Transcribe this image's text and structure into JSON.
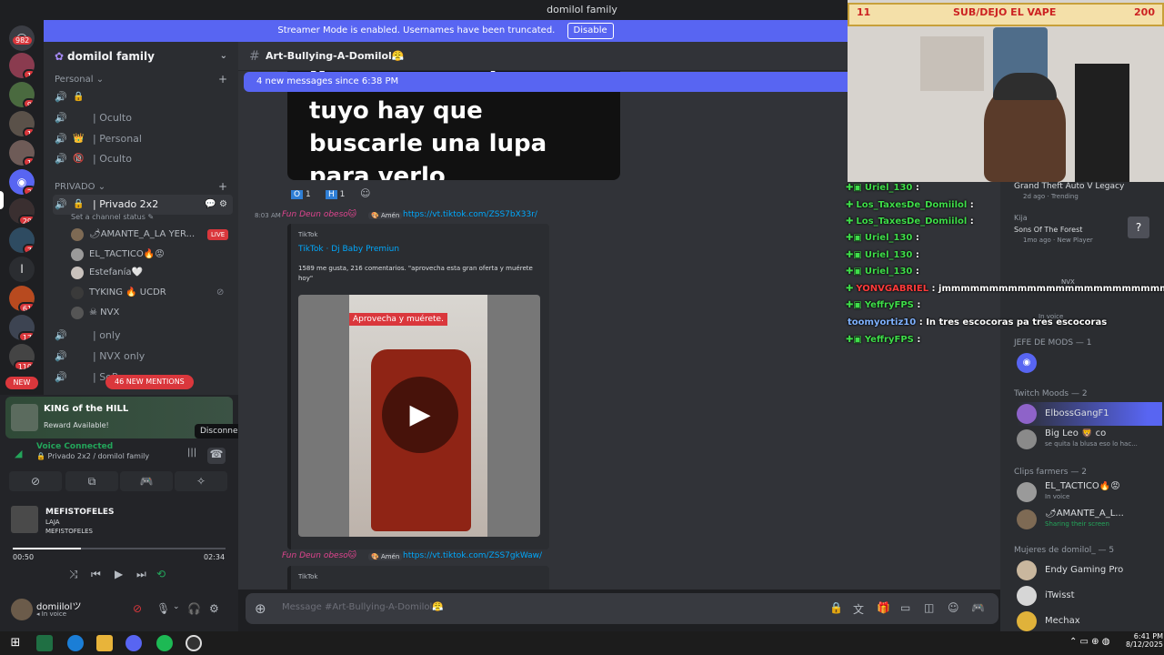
{
  "window": {
    "title": "domilol family"
  },
  "streamer_bar": {
    "text": "Streamer Mode is enabled. Usernames have been truncated.",
    "disable_label": "Disable"
  },
  "rail": {
    "top_badge": "982",
    "servers": [
      {
        "badge": "1"
      },
      {
        "badge": "9"
      },
      {
        "badge": "1"
      },
      {
        "badge": "1"
      },
      {
        "badge": "2"
      },
      {
        "badge": "29"
      },
      {
        "badge": "7"
      },
      {
        "badge": ""
      },
      {
        "badge": "61"
      },
      {
        "badge": "17"
      },
      {
        "badge": "110"
      }
    ],
    "new_label": "NEW"
  },
  "sidebar": {
    "guild_name": "domilol family",
    "cat_personal": "Personal",
    "personal_channels": [
      {
        "icon": "🔒",
        "name": ""
      },
      {
        "icon": "|",
        "name": "| Oculto"
      },
      {
        "icon": "👑",
        "name": "| Personal"
      },
      {
        "icon": "🔞",
        "name": "| Oculto"
      }
    ],
    "cat_privado": "PRIVADO",
    "active_channel": "| Privado 2x2",
    "channel_status": "Set a channel status ✎",
    "voice_users": [
      {
        "name": "🌶AMANTE_A_LA YER...",
        "tag": "LIVE"
      },
      {
        "name": "EL_TACTICO🔥😡",
        "tag": ""
      },
      {
        "name": "Estefanía🤍",
        "tag": ""
      },
      {
        "name": "TYKING 🔥 UCDR",
        "tag": ""
      },
      {
        "name": "☠ NVX",
        "tag": ""
      }
    ],
    "other_channels": [
      {
        "name": "| only"
      },
      {
        "name": "| NVX only"
      },
      {
        "name": "| SoP..."
      }
    ],
    "new_mentions": "46 NEW MENTIONS"
  },
  "user_panel": {
    "promo_title": "KING of the HILL",
    "promo_sub": "Reward Available!",
    "voice_status": "Voice Connected",
    "voice_channel": "Privado 2x2 / domilol family",
    "disconnect_tooltip": "Disconnect",
    "song_title": "MEFISTOFELES",
    "song_album": "LAJA",
    "song_artist": "MEFISTOFELES",
    "time_current": "00:50",
    "time_total": "02:34",
    "progress": 0.32,
    "username": "domiilolツ",
    "user_status": "In voice"
  },
  "chat": {
    "channel_name": "Art-Bullying-A-Domilol😤",
    "new_messages": "4 new messages since 6:38 PM",
    "image_text": "Yo creo que el guevo tuyo hay que buscarle una lupa para verlo",
    "reactions": [
      {
        "emoji": "O",
        "count": "1"
      },
      {
        "emoji": "H",
        "count": "1"
      }
    ],
    "msg1": {
      "time": "8:03 AM",
      "author": "Fun Deun obeso🐱",
      "role": "🎨 Amén",
      "link": "https://vt.tiktok.com/ZSS7bX33r/",
      "embed_site": "TikTok",
      "embed_title": "TikTok · Dj Baby Premiun",
      "embed_desc": "1589 me gusta, 216 comentarios. \"aprovecha esta gran oferta y muérete hoy\"",
      "video_caption": "Aprovecha y muérete."
    },
    "msg2": {
      "author": "Fun Deun obeso🐱",
      "role": "🎨 Amén",
      "link": "https://vt.tiktok.com/ZSS7gkWaw/",
      "embed_site": "TikTok"
    },
    "composer_placeholder": "Message #Art-Bullying-A-Domilol😤"
  },
  "overlay": {
    "sub_left": "11",
    "sub_text": "SUB/DEJO EL VAPE",
    "sub_right": "200"
  },
  "twitch_chat": [
    {
      "user": "Uriel_130",
      "msg": ""
    },
    {
      "user": "Los_TaxesDe_Domiilol",
      "msg": ""
    },
    {
      "user": "Los_TaxesDe_Domiilol",
      "msg": ""
    },
    {
      "user": "Uriel_130",
      "msg": ""
    },
    {
      "user": "Uriel_130",
      "msg": ""
    },
    {
      "user": "Uriel_130",
      "msg": ""
    },
    {
      "user": "YONVGABRIEL",
      "msg": "jmmmmmmmmmmmmmmmmmmmmmmmm"
    },
    {
      "user": "YeffryFPS",
      "msg": ""
    },
    {
      "user": "toomyortiz10",
      "msg": "In tres escocoras pa tres escocoras"
    },
    {
      "user": "YeffryFPS",
      "msg": ""
    }
  ],
  "members": {
    "activity1": {
      "title": "Grand Theft Auto V Legacy",
      "sub": "2d ago · Trending"
    },
    "activity2": {
      "name": "Kija",
      "title": "Sons Of The Forest",
      "sub": "1mo ago · New Player"
    },
    "nvx": "NVX",
    "nvx_status": "In voice",
    "group_jefe": "JEFE DE MODS — 1",
    "group_twitch": "Twitch Moods — 2",
    "twitch_mods": [
      {
        "name": "ElbossGangF1",
        "status": ""
      },
      {
        "name": "Big Leo 🦁 co",
        "status": "se quita la blusa eso lo hac..."
      }
    ],
    "group_clips": "Clips farmers — 2",
    "clips": [
      {
        "name": "EL_TACTICO🔥😡",
        "status": "In voice"
      },
      {
        "name": "🌶AMANTE_A_L...",
        "status": "Sharing their screen"
      }
    ],
    "group_mujeres": "Mujeres de domilol_ — 5",
    "mujeres": [
      {
        "name": "Endy Gaming Pro",
        "status": ""
      },
      {
        "name": "iTwisst",
        "status": ""
      },
      {
        "name": "Mechax",
        "status": ""
      }
    ]
  },
  "taskbar": {
    "time": "6:41 PM",
    "date": "8/12/2025"
  },
  "colors": {
    "blurple": "#5865f2",
    "live": "#da373c",
    "bg": "#313338",
    "green": "#23a55a"
  }
}
